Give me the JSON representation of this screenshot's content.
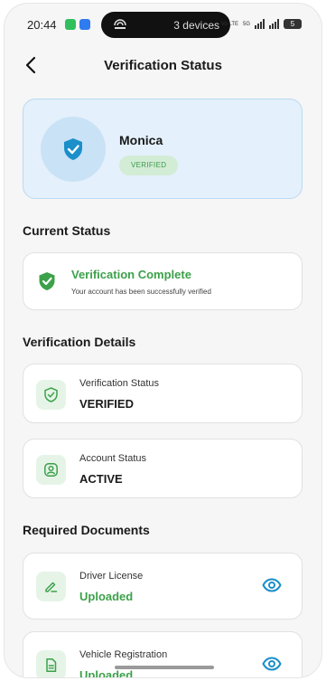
{
  "status_bar": {
    "time": "20:44",
    "cast_label": "3 devices",
    "network_small": "Vo LTE",
    "network_speed": "5G",
    "battery": "5"
  },
  "header": {
    "title": "Verification Status"
  },
  "profile": {
    "name": "Monica",
    "badge": "VERIFIED"
  },
  "current_status": {
    "section_title": "Current Status",
    "title": "Verification Complete",
    "subtitle": "Your account has been successfully verified"
  },
  "verification_details": {
    "section_title": "Verification Details",
    "items": [
      {
        "label": "Verification Status",
        "value": "VERIFIED",
        "icon": "shield-check-icon"
      },
      {
        "label": "Account Status",
        "value": "ACTIVE",
        "icon": "user-circle-icon"
      }
    ]
  },
  "required_documents": {
    "section_title": "Required Documents",
    "items": [
      {
        "label": "Driver License",
        "value": "Uploaded",
        "icon": "pencil-icon"
      },
      {
        "label": "Vehicle Registration",
        "value": "Uploaded",
        "icon": "document-icon"
      }
    ]
  },
  "colors": {
    "accent_green": "#3ca14a",
    "accent_blue": "#1a8fc9",
    "profile_bg": "#e4f0fb"
  }
}
